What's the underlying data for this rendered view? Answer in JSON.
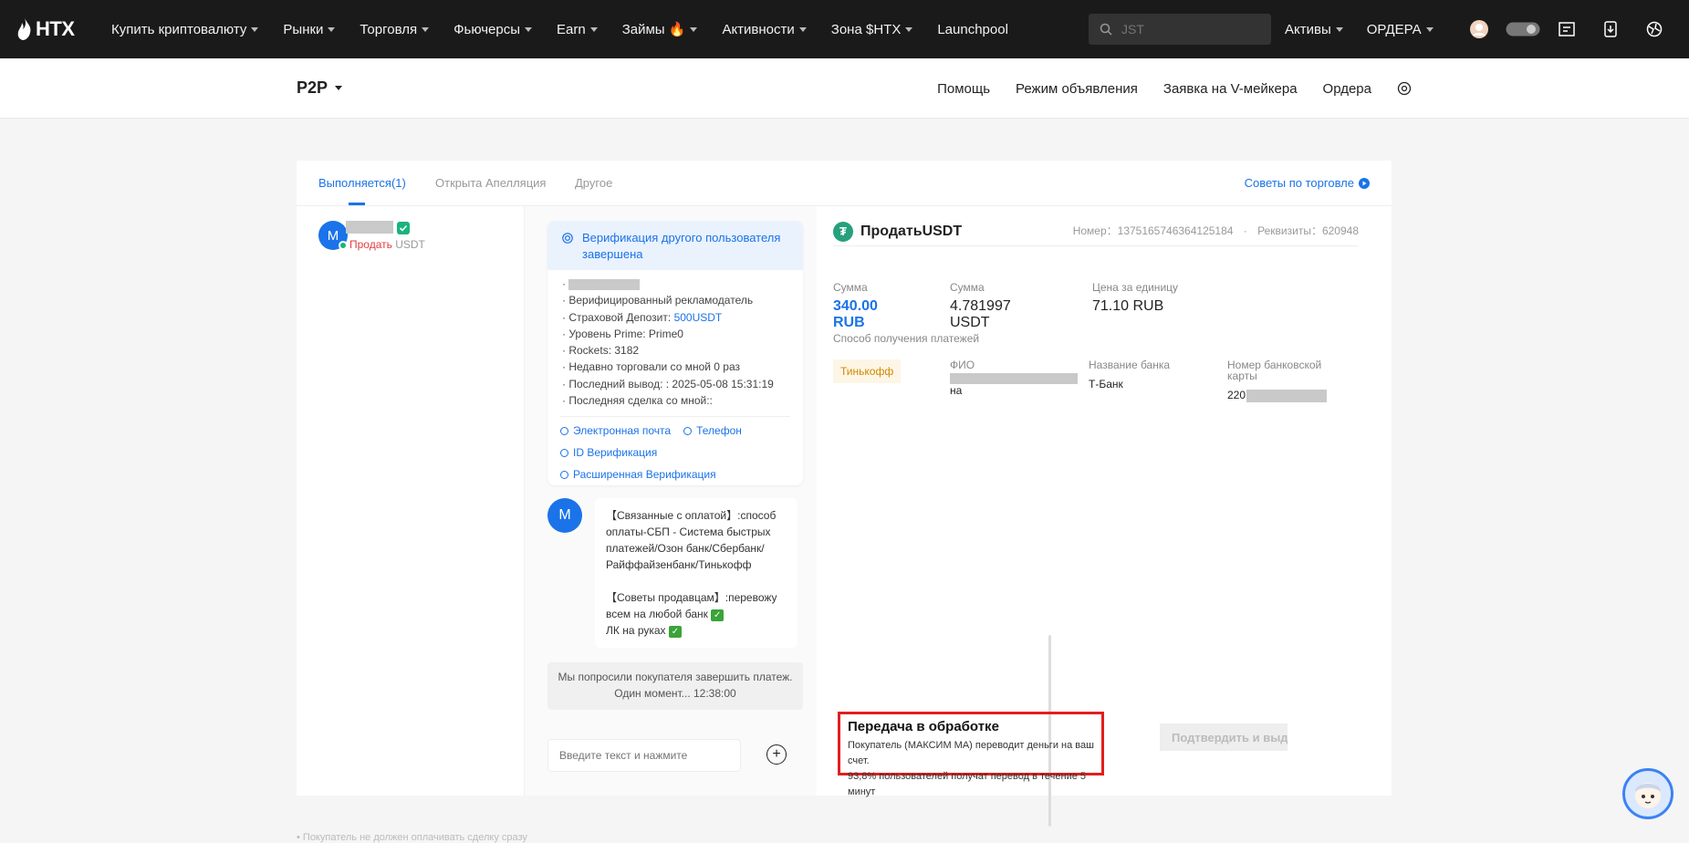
{
  "nav": {
    "logo": "HTX",
    "items": [
      "Купить криптовалюту",
      "Рынки",
      "Торговля",
      "Фьючерсы",
      "Earn",
      "Займы 🔥",
      "Активности",
      "Зона $HTX",
      "Launchpool"
    ],
    "search_placeholder": "JST",
    "right_items": [
      "Активы",
      "ОРДЕРА"
    ]
  },
  "subnav": {
    "title": "P2P",
    "links": [
      "Помощь",
      "Режим объявления",
      "Заявка на V-мейкера",
      "Ордера"
    ]
  },
  "tabs": [
    "Выполняется(1)",
    "Открыта Апелляция",
    "Другое"
  ],
  "tips_label": "Советы по торговле",
  "order_list": {
    "avatar_letter": "M",
    "side": "Продать",
    "asset": "USDT"
  },
  "verify_card": {
    "title": "Верификация другого пользователя завершена",
    "lines": [
      "Верифицированный рекламодатель",
      "Страховой Депозит: ",
      "Уровень Prime: Prime0",
      "Rockets: 3182",
      "Недавно торговали со мной 0 раз",
      "Последний вывод: : 2025-05-08 15:31:19",
      "Последняя сделка со мной::"
    ],
    "deposit_value": "500USDT",
    "links": [
      "Электронная почта",
      "Телефон",
      "ID Верификация",
      "Расширенная Верификация"
    ]
  },
  "message": {
    "avatar_letter": "M",
    "para1": "【Связанные с оплатой】:способ оплаты-СБП - Система быстрых платежей/Озон банк/Сбербанк/Райффайзенбанк/Тинькофф",
    "para2": "【Советы продавцам】:перевожу всем на любой банк",
    "para3": "ЛК на руках",
    "check_glyph": "✓"
  },
  "system_msg": {
    "line1": "Мы попросили покупателя завершить платеж.",
    "line2": "Один момент... 12:38:00"
  },
  "chat_input_placeholder": "Введите текст и нажмите",
  "order": {
    "title": "ПродатьUSDT",
    "number_label": "Номер：",
    "number": "1375165746364125184",
    "req_label": "Реквизиты：",
    "req": "620948",
    "amounts": [
      {
        "label": "Сумма",
        "value": "340.00 RUB"
      },
      {
        "label": "Сумма",
        "value": "4.781997 USDT"
      },
      {
        "label": "Цена за единицу",
        "value": "71.10 RUB"
      }
    ],
    "payment_label": "Способ получения платежей",
    "bank_badge": "Тинькофф",
    "fio_label": "ФИО",
    "fio_value": "на",
    "bank_label": "Название банка",
    "bank_value": "Т-Банк",
    "card_label": "Номер банковской карты",
    "card_prefix": "220"
  },
  "status": {
    "title": "Передача в обработке",
    "line1": "Покупатель (МАКСИМ МА) переводит деньги на ваш счет.",
    "line2": "93,8% пользователей получат перевод в течение 5 минут"
  },
  "confirm_button": "Подтвердить и выдать",
  "bottom_note": "• Покупатель не должен оплачивать сделку сразу"
}
